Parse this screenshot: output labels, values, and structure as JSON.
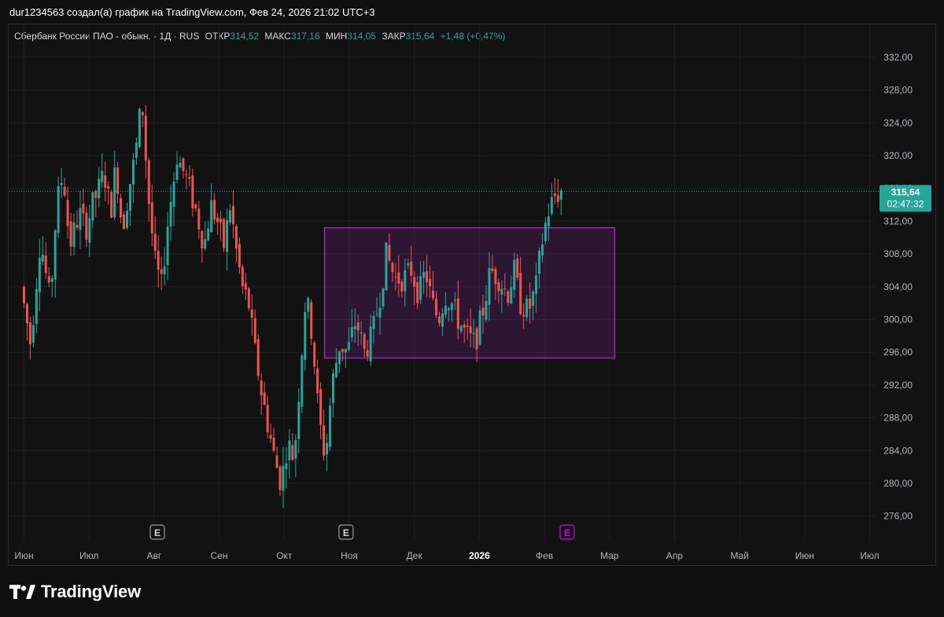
{
  "caption": "dur1234563 создал(а) график на TradingView.com, Фев 24, 2026 21:02 UTC+3",
  "legend": {
    "symbol": "Сбербанк России ПАО - обыкн. · 1Д · RUS",
    "open_label": "ОТКР",
    "open": "314,52",
    "high_label": "МАКС",
    "high": "317,16",
    "low_label": "МИН",
    "low": "314,05",
    "close_label": "ЗАКР",
    "close": "315,64",
    "change": "+1,48 (+0,47%)"
  },
  "price_tag": {
    "price": "315,64",
    "countdown": "02:47:32"
  },
  "event_markers": [
    {
      "label": "E",
      "month_pos": 2.05
    },
    {
      "label": "E",
      "month_pos": 4.95
    },
    {
      "label": "E",
      "month_pos": 8.35
    }
  ],
  "brand": {
    "name": "TradingView"
  },
  "colors": {
    "up": "#26a69a",
    "down": "#ef5350",
    "box": "#9c27b0",
    "background": "#121212"
  },
  "chart_data": {
    "type": "candlestick",
    "y_ticks": [
      "332,00",
      "328,00",
      "324,00",
      "320,00",
      "316,00",
      "312,00",
      "308,00",
      "304,00",
      "300,00",
      "296,00",
      "292,00",
      "288,00",
      "284,00",
      "280,00",
      "276,00"
    ],
    "ylim": [
      273,
      334
    ],
    "x_ticks": [
      "Июн",
      "Июл",
      "Авг",
      "Сен",
      "Окт",
      "Ноя",
      "Дек",
      "2026",
      "Фев",
      "Мар",
      "Апр",
      "Май",
      "Июн",
      "Июл"
    ],
    "last_price": 315.64,
    "range_box": {
      "from_month": 4.62,
      "to_month": 9.08,
      "low": 295.3,
      "high": 311.2
    },
    "price_path": [
      [
        0.0,
        304
      ],
      [
        0.15,
        297
      ],
      [
        0.3,
        310
      ],
      [
        0.45,
        302
      ],
      [
        0.55,
        314
      ],
      [
        0.65,
        318
      ],
      [
        0.75,
        309
      ],
      [
        0.9,
        313
      ],
      [
        1.0,
        311
      ],
      [
        1.1,
        314
      ],
      [
        1.2,
        316
      ],
      [
        1.28,
        318
      ],
      [
        1.38,
        313
      ],
      [
        1.46,
        319
      ],
      [
        1.56,
        311
      ],
      [
        1.66,
        316
      ],
      [
        1.76,
        320
      ],
      [
        1.86,
        327
      ],
      [
        1.96,
        315
      ],
      [
        2.06,
        307
      ],
      [
        2.16,
        304
      ],
      [
        2.26,
        312
      ],
      [
        2.4,
        320
      ],
      [
        2.55,
        317
      ],
      [
        2.7,
        313
      ],
      [
        2.82,
        309
      ],
      [
        2.92,
        314
      ],
      [
        3.02,
        312
      ],
      [
        3.12,
        309
      ],
      [
        3.22,
        314
      ],
      [
        3.3,
        309
      ],
      [
        3.4,
        304
      ],
      [
        3.5,
        302
      ],
      [
        3.6,
        296
      ],
      [
        3.7,
        291
      ],
      [
        3.8,
        287
      ],
      [
        3.9,
        283
      ],
      [
        4.0,
        280
      ],
      [
        4.1,
        285
      ],
      [
        4.2,
        283
      ],
      [
        4.28,
        292
      ],
      [
        4.38,
        303
      ],
      [
        4.48,
        298
      ],
      [
        4.58,
        288
      ],
      [
        4.68,
        283
      ],
      [
        4.78,
        292
      ],
      [
        4.9,
        297
      ],
      [
        5.02,
        296
      ],
      [
        5.15,
        300
      ],
      [
        5.28,
        296
      ],
      [
        5.4,
        298
      ],
      [
        5.52,
        303
      ],
      [
        5.62,
        308
      ],
      [
        5.75,
        305
      ],
      [
        5.88,
        305
      ],
      [
        6.0,
        306
      ],
      [
        6.12,
        303
      ],
      [
        6.22,
        306
      ],
      [
        6.32,
        302
      ],
      [
        6.42,
        300
      ],
      [
        6.52,
        303
      ],
      [
        6.62,
        302
      ],
      [
        6.72,
        300
      ],
      [
        6.85,
        298
      ],
      [
        6.98,
        297
      ],
      [
        7.1,
        301
      ],
      [
        7.22,
        306
      ],
      [
        7.35,
        305
      ],
      [
        7.48,
        303
      ],
      [
        7.58,
        306
      ],
      [
        7.68,
        302
      ],
      [
        7.8,
        301
      ],
      [
        7.92,
        304
      ],
      [
        8.0,
        309
      ],
      [
        8.1,
        313
      ],
      [
        8.2,
        315
      ],
      [
        8.3,
        315.64
      ]
    ]
  }
}
